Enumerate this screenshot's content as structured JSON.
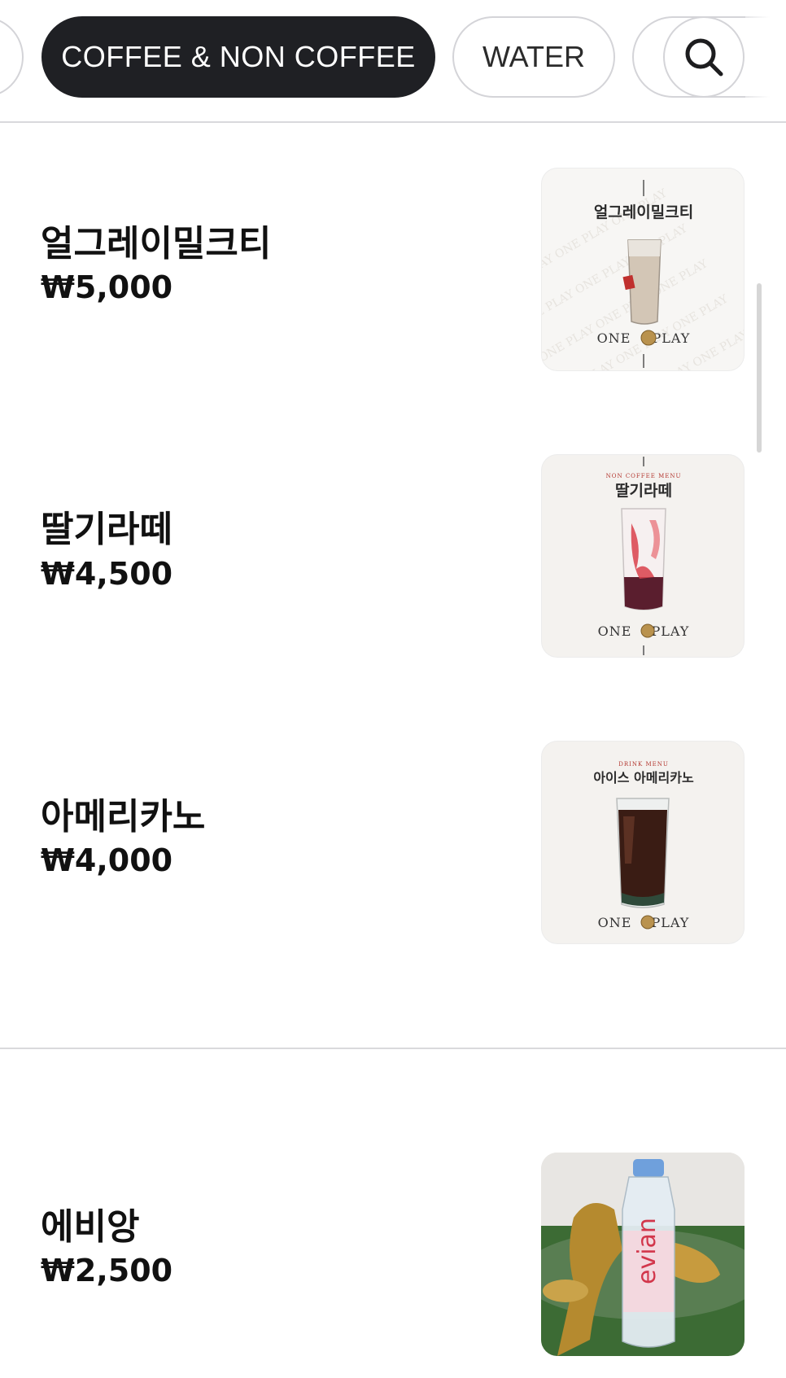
{
  "tabs": {
    "active_label": "COFFEE & NON COFFEE",
    "water_label": "WATER"
  },
  "items": [
    {
      "name": "얼그레이밀크티",
      "price": "₩5,000",
      "poster_title": "얼그레이밀크티",
      "poster_brand_left": "ONE",
      "poster_brand_right": "PLAY"
    },
    {
      "name": "딸기라떼",
      "price": "₩4,500",
      "poster_tag": "NON COFFEE MENU",
      "poster_title": "딸기라떼",
      "poster_brand_left": "ONE",
      "poster_brand_right": "PLAY"
    },
    {
      "name": "아메리카노",
      "price": "₩4,000",
      "poster_tag": "DRINK MENU",
      "poster_title": "아이스 아메리카노",
      "poster_brand_left": "ONE",
      "poster_brand_right": "PLAY"
    },
    {
      "name": "에비앙",
      "price": "₩2,500",
      "bottle_label": "evian"
    }
  ],
  "colors": {
    "active_pill": "#1f2024",
    "divider": "#d9d9dc",
    "text": "#111111"
  },
  "icons": {
    "search": "search-icon"
  }
}
